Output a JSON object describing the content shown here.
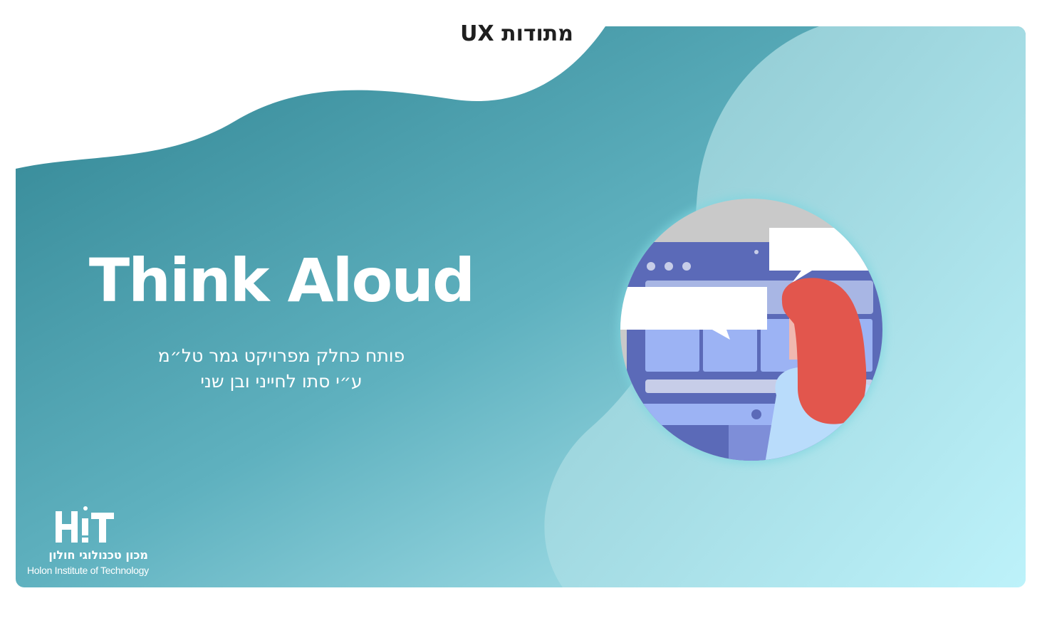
{
  "slide": {
    "category": "מתודות UX",
    "title": "Think Aloud",
    "subtitle_line1": "פותח כחלק מפרויקט גמר טל״מ",
    "subtitle_line2": "ע״י סתו לחייני ובן שני"
  },
  "logo": {
    "mark": "H!T",
    "name_he": "מכון טכנולוגי חולון",
    "name_en": "Holon Institute of Technology"
  },
  "colors": {
    "gradient_dark": "#2f8391",
    "gradient_light": "#c2f4fb",
    "hair": "#e2564d",
    "screen_frame": "#5b6ab8",
    "screen_panel": "#9cb3f4"
  },
  "illustration": {
    "icons": [
      "person-icon",
      "monitor-icon",
      "speech-bubble-icon"
    ]
  }
}
